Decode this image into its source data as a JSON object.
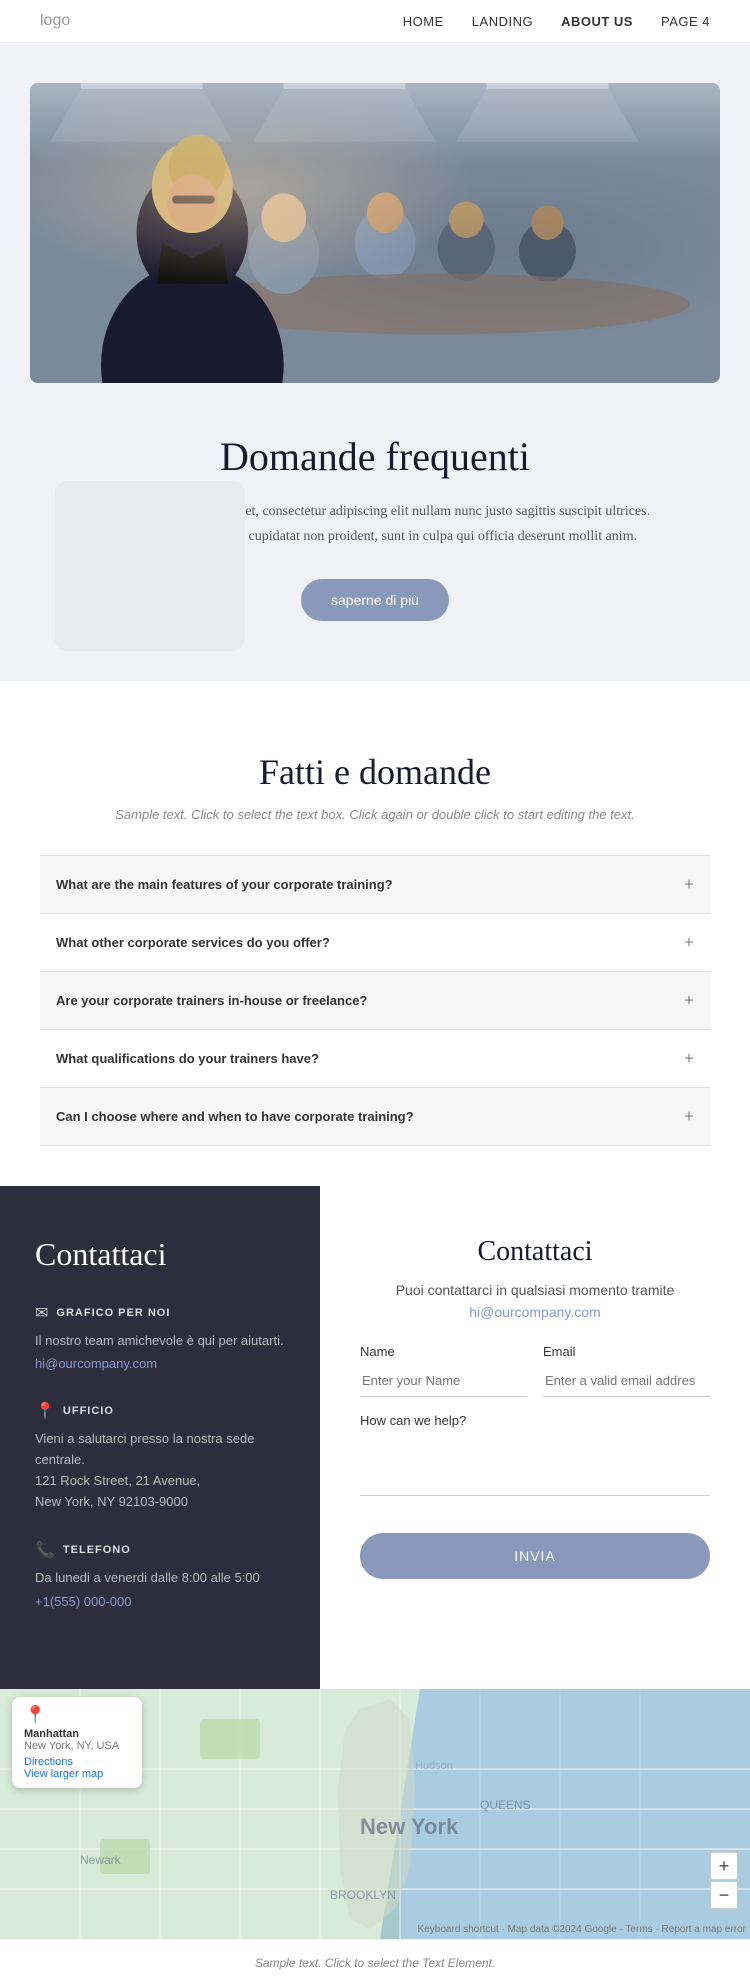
{
  "nav": {
    "logo": "logo",
    "links": [
      {
        "label": "HOME",
        "active": false
      },
      {
        "label": "LANDING",
        "active": false
      },
      {
        "label": "ABOUT US",
        "active": true
      },
      {
        "label": "PAGE 4",
        "active": false
      }
    ]
  },
  "hero": {
    "title": "Domande frequenti",
    "description": "Lorem ipsum dolor sit amet, consectetur adipiscing elit nullam nunc justo sagittis suscipit ultrices. Excepteur sint occaecat cupidatat non proident, sunt in culpa qui officia deserunt mollit anim.",
    "button_label": "saperne di più"
  },
  "faq_section": {
    "title": "Fatti e domande",
    "subtitle": "Sample text. Click to select the text box. Click again or double click to start editing the text.",
    "items": [
      {
        "question": "What are the main features of your corporate training?"
      },
      {
        "question": "What other corporate services do you offer?"
      },
      {
        "question": "Are your corporate trainers in-house or freelance?"
      },
      {
        "question": "What qualifications do your trainers have?"
      },
      {
        "question": "Can I choose where and when to have corporate training?"
      }
    ]
  },
  "contact_left": {
    "title": "Contattaci",
    "blocks": [
      {
        "icon": "✉",
        "title": "GRAFICO PER NOI",
        "text": "Il nostro team amichevole è qui per aiutarti.",
        "link": "hi@ourcompany.com"
      },
      {
        "icon": "📍",
        "title": "UFFICIO",
        "text": "Vieni a salutarci presso la nostra sede centrale.\n121 Rock Street, 21 Avenue,\nNew York, NY 92103-9000",
        "link": null
      },
      {
        "icon": "📞",
        "title": "TELEFONO",
        "text": "Da lunedi a venerdi dalle 8:00 alle 5:00",
        "link": "+1(555) 000-000"
      }
    ]
  },
  "contact_right": {
    "title": "Contattaci",
    "subtitle": "Puoi contattarci in qualsiasi momento tramite",
    "email": "hi@ourcompany.com",
    "form": {
      "name_label": "Name",
      "name_placeholder": "Enter your Name",
      "email_label": "Email",
      "email_placeholder": "Enter a valid email addres",
      "message_label": "How can we help?",
      "submit_label": "INVIA"
    }
  },
  "map": {
    "location_name": "Manhattan",
    "location_sub": "New York, NY, USA",
    "directions_label": "Directions",
    "view_map_label": "View larger map",
    "ny_label": "New York",
    "attribution": "Keyboard shortcut · Map data ©2024 Google · Terms · Report a map error"
  },
  "footer": {
    "text": "Sample text. Click to select the Text Element."
  }
}
